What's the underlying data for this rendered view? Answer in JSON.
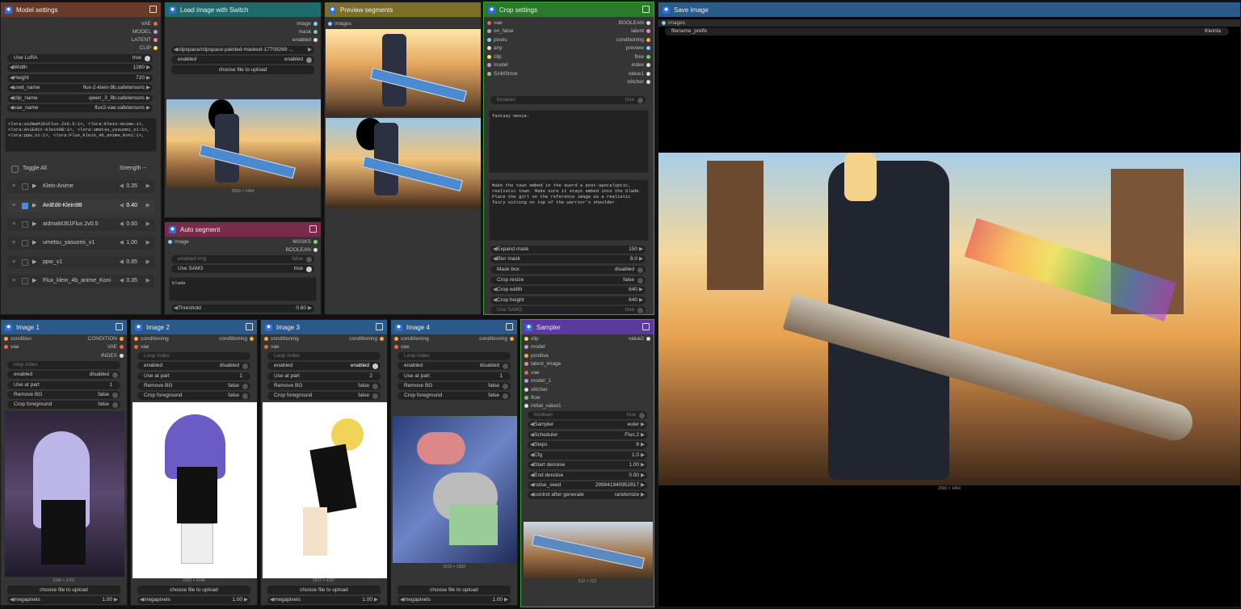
{
  "model_settings": {
    "title": "Model settings",
    "outputs": [
      "VAE",
      "MODEL",
      "LATENT",
      "CLIP"
    ],
    "use_lora": {
      "label": "Use LoRA",
      "value": "true"
    },
    "width": {
      "label": "Width",
      "value": "1280"
    },
    "height": {
      "label": "Height",
      "value": "720"
    },
    "unet_name": {
      "label": "unet_name",
      "value": "flux-2-klein-9b.safetensors"
    },
    "clip_name": {
      "label": "clip_name",
      "value": "qwen_3_8b.safetensors"
    },
    "vae_name": {
      "label": "vae_name",
      "value": "flux2-vae.safetensors"
    },
    "lora_text": "<lora:aidmaMJ61Flux.2v0.5:1>, <lora:Klein-Anime:1>, <lora:AniEdit-Klein9B:1>, <lora:umetsu_yasuomi_v1:1>, <lora:ppw_v1:1>, <lora:Flux_Klein_4b_anime_Koni:1>,",
    "toggle_all": "Toggle All",
    "strength": "Strength --",
    "loras": [
      {
        "name": "Klein-Anime",
        "val": "0.35"
      },
      {
        "name": "AniEdit-Klein9B",
        "val": "0.40"
      },
      {
        "name": "aidmaMJ61Flux.2v0.5",
        "val": "0.60"
      },
      {
        "name": "umetsu_yasuomi_v1",
        "val": "1.00"
      },
      {
        "name": "ppw_v1",
        "val": "0.85"
      },
      {
        "name": "Flux_klein_4b_anime_Koni",
        "val": "0.35"
      }
    ]
  },
  "load_image": {
    "title": "Load Image with Switch",
    "outputs": [
      "image",
      "mask",
      "enabled"
    ],
    "file": "clipspace/clipspace-painted-masked-17709269 ...",
    "enabled_label": "enabled",
    "enabled_value": "enabled",
    "upload": "choose file to upload",
    "size": "2560 × 1464"
  },
  "preview": {
    "title": "Preview segments",
    "input": "images"
  },
  "auto_segment": {
    "title": "Auto segment",
    "input": "image",
    "outputs": [
      "MASKS",
      "BOOLEAN"
    ],
    "enabled_img": "enabled img",
    "enabled_img_val": "false",
    "use_sam3": "Use SAM3",
    "use_sam3_val": "true",
    "prompt": "blade",
    "threshold": "Threshold",
    "threshold_val": "0.60"
  },
  "crop": {
    "title": "Crop settings",
    "inputs": [
      "vae",
      "on_false",
      "pixels",
      "any",
      "clip",
      "model",
      "SAM3msk"
    ],
    "outputs": [
      "BOOLEAN",
      "latent",
      "conditioning",
      "preview",
      "flow",
      "index",
      "value1",
      "stitcher"
    ],
    "boolean": "boolean",
    "boolean_val": "true",
    "text1": "fantasy movie.",
    "text2": "Make the town embed in the sword a post-apocalyptic, realistic town. Make sure it stays embed into the blade.\nPlace the girl on the reference image as a realistic fairy sitting on top of the warrior's shoulder.",
    "params": [
      {
        "l": "Expand mask",
        "v": "150"
      },
      {
        "l": "Blur mask",
        "v": "8.0"
      },
      {
        "l": "Mask box",
        "v": "disabled"
      },
      {
        "l": "Crop resize",
        "v": "false"
      },
      {
        "l": "Crop width",
        "v": "640"
      },
      {
        "l": "Crop height",
        "v": "640"
      },
      {
        "l": "Use SAM3",
        "v": "true"
      }
    ]
  },
  "save": {
    "title": "Save Image",
    "input": "images",
    "prefix_label": "filename_prefix",
    "prefix": "KleinIa",
    "size": "2560 × 1464"
  },
  "images": [
    {
      "title": "Image 1",
      "in": [
        "condition",
        "vae"
      ],
      "out": [
        "CONDITION",
        "VAE",
        "INDEX"
      ],
      "loop": "loop index",
      "r": [
        {
          "l": "enabled",
          "v": "disabled"
        },
        {
          "l": "Use at part",
          "v": "1"
        },
        {
          "l": "Remove BG",
          "v": "false"
        },
        {
          "l": "Crop foreground",
          "v": "false"
        }
      ],
      "size": "1199 × 1701",
      "upload": "choose file to upload",
      "mp": "megapixels",
      "mpv": "1.00"
    },
    {
      "title": "Image 2",
      "in": [
        "conditioning",
        "vae"
      ],
      "out": [
        "conditioning"
      ],
      "loop": "Loop index",
      "r": [
        {
          "l": "enabled",
          "v": "disabled"
        },
        {
          "l": "Use at part",
          "v": "1"
        },
        {
          "l": "Remove BG",
          "v": "false"
        },
        {
          "l": "Crop foreground",
          "v": "false"
        }
      ],
      "size": "2993 × 4146",
      "upload": "choose file to upload",
      "mp": "megapixels",
      "mpv": "1.00"
    },
    {
      "title": "Image 3",
      "in": [
        "conditioning",
        "vae"
      ],
      "out": [
        "conditioning"
      ],
      "loop": "Loop index",
      "r": [
        {
          "l": "enabled",
          "v": "enabled"
        },
        {
          "l": "Use at part",
          "v": "2"
        },
        {
          "l": "Remove BG",
          "v": "false"
        },
        {
          "l": "Crop foreground",
          "v": "false"
        }
      ],
      "size": "2927 × 4167",
      "upload": "choose file to upload",
      "mp": "megapixels",
      "mpv": "1.00"
    },
    {
      "title": "Image 4",
      "in": [
        "conditioning",
        "vae"
      ],
      "out": [
        "conditioning"
      ],
      "loop": "Loop index",
      "r": [
        {
          "l": "enabled",
          "v": "disabled"
        },
        {
          "l": "Use at part",
          "v": "1"
        },
        {
          "l": "Remove BG",
          "v": "false"
        },
        {
          "l": "Crop foreground",
          "v": "false"
        }
      ],
      "size": "1615 × 1903",
      "upload": "choose file to upload",
      "mp": "megapixels",
      "mpv": "1.00"
    }
  ],
  "sampler": {
    "title": "Sampler",
    "inputs": [
      "clip",
      "model",
      "positive",
      "latent_image",
      "vae",
      "model_1",
      "stitcher",
      "flow",
      "initial_value1"
    ],
    "output": "value2",
    "boolean": "boolean",
    "boolean_val": "true",
    "params": [
      {
        "l": "Sampler",
        "v": "euler"
      },
      {
        "l": "Scheduler",
        "v": "Flux.2"
      },
      {
        "l": "Steps",
        "v": "8"
      },
      {
        "l": "Cfg",
        "v": "1.0"
      },
      {
        "l": "Start denoise",
        "v": "1.00"
      },
      {
        "l": "End denoise",
        "v": "0.00"
      },
      {
        "l": "noise_seed",
        "v": "299941940952817"
      },
      {
        "l": "control after generate",
        "v": "randomize"
      }
    ],
    "size": "512 × 222"
  }
}
